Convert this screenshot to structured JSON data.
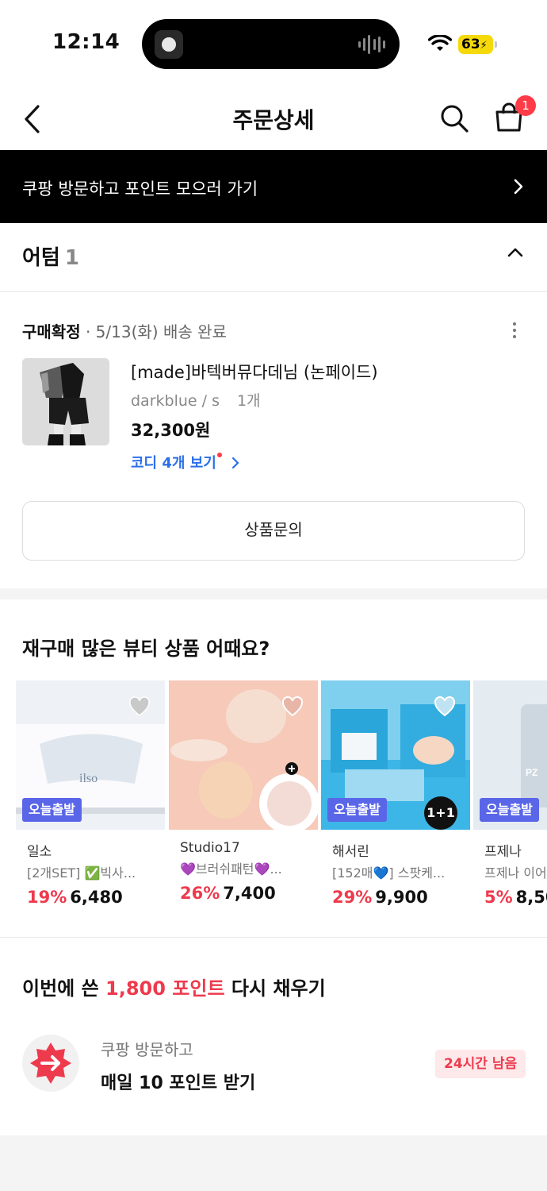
{
  "status_bar": {
    "time": "12:14",
    "battery": "63"
  },
  "header": {
    "title": "주문상세",
    "cart_count": "1"
  },
  "banner": {
    "text": "쿠팡 방문하고 포인트 모으러 가기"
  },
  "shop": {
    "name": "어텀",
    "count": "1"
  },
  "order": {
    "status": "구매확정",
    "status_detail": " · 5/13(화) 배송 완료",
    "product_name": "[made]바텍버뮤다데님 (논페이드)",
    "option": "darkblue / s",
    "quantity": "1개",
    "price": "32,300원",
    "codi_link": "코디 4개 보기",
    "inquiry_button": "상품문의"
  },
  "recommend": {
    "title": "재구매 많은 뷰티 상품 어때요?",
    "tag_label": "오늘출발",
    "items": [
      {
        "brand": "일소",
        "desc": "[2개SET] ✅빅사...",
        "discount": "19%",
        "price": "6,480"
      },
      {
        "brand": "Studio17",
        "desc": "💜브러쉬패턴💜...",
        "discount": "26%",
        "price": "7,400"
      },
      {
        "brand": "해서린",
        "desc": "[152매💙] 스팟케...",
        "discount": "29%",
        "price": "9,900",
        "badge": "1+1"
      },
      {
        "brand": "프제나",
        "desc": "프제나 이어",
        "discount": "5%",
        "price": "8,50"
      }
    ]
  },
  "points": {
    "title_prefix": "이번에 쓴 ",
    "title_highlight": "1,800 포인트",
    "title_suffix": " 다시 채우기",
    "subtitle": "쿠팡 방문하고",
    "main": "매일 10 포인트 받기",
    "badge": "24시간 남음"
  },
  "colors": {
    "accent_red": "#ee3a4d",
    "link_blue": "#2b6fe8",
    "tag_purple": "#5a66e8",
    "banner_bg": "#000000"
  }
}
